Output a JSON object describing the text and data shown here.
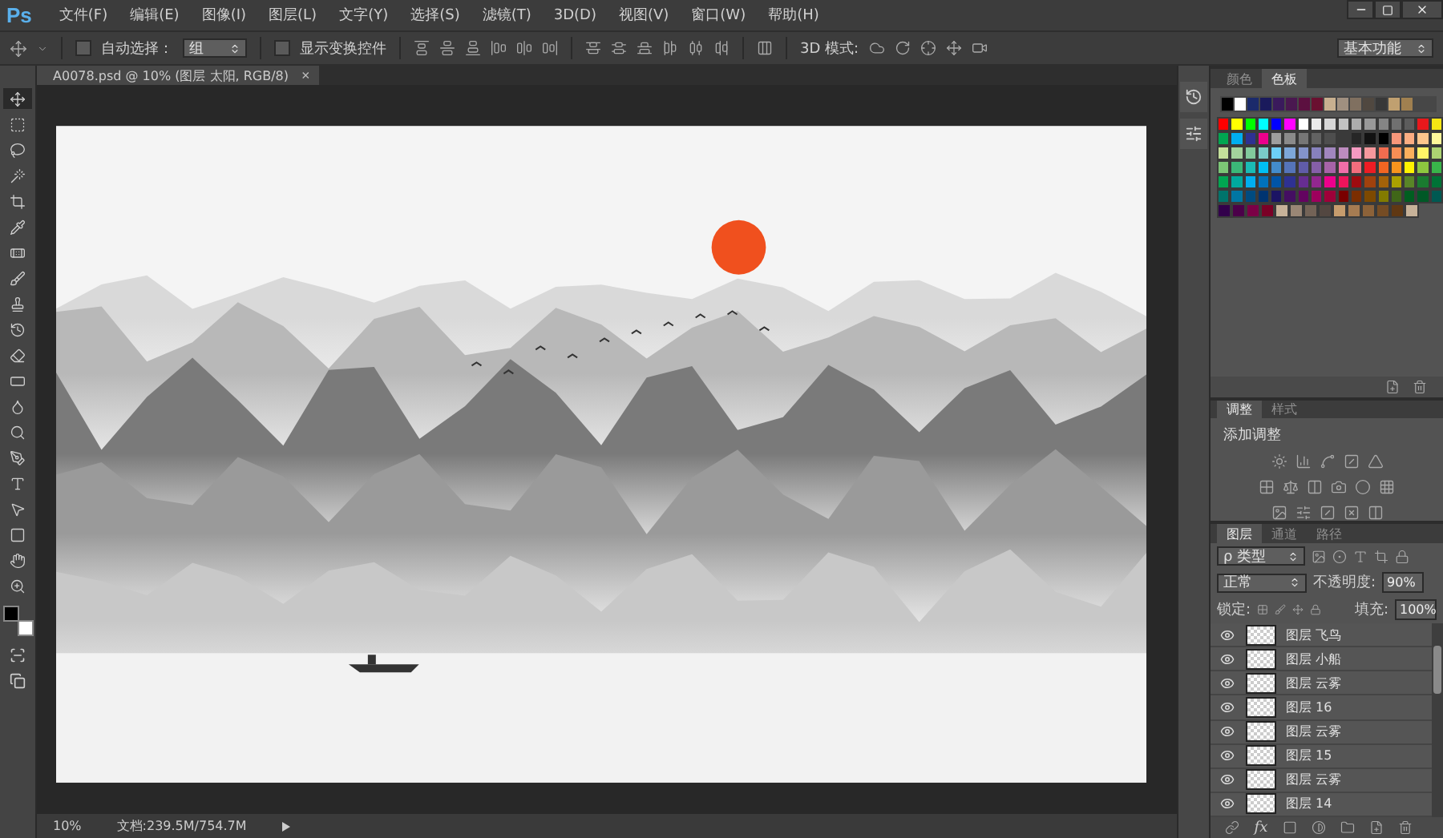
{
  "menu": {
    "logo": "Ps",
    "items": [
      "文件(F)",
      "编辑(E)",
      "图像(I)",
      "图层(L)",
      "文字(Y)",
      "选择(S)",
      "滤镜(T)",
      "3D(D)",
      "视图(V)",
      "窗口(W)",
      "帮助(H)"
    ]
  },
  "options_bar": {
    "auto_select": {
      "label": "自动选择：",
      "checked": false,
      "value": "组"
    },
    "show_transform": {
      "label": "显示变换控件",
      "checked": false
    },
    "mode_label": "3D 模式:",
    "workspace": "基本功能"
  },
  "document_tab": {
    "title": "A0078.psd @ 10% (图层 太阳, RGB/8)",
    "close": "×"
  },
  "tools": [
    {
      "kind": "move",
      "selected": true
    },
    {
      "kind": "marquee",
      "selected": false
    },
    {
      "kind": "lasso",
      "selected": false
    },
    {
      "kind": "wand",
      "selected": false
    },
    {
      "kind": "crop",
      "selected": false
    },
    {
      "kind": "eyedropper",
      "selected": false
    },
    {
      "kind": "heal",
      "selected": false
    },
    {
      "kind": "brush",
      "selected": false
    },
    {
      "kind": "stamp",
      "selected": false
    },
    {
      "kind": "history",
      "selected": false
    },
    {
      "kind": "eraser",
      "selected": false
    },
    {
      "kind": "gradient",
      "selected": false
    },
    {
      "kind": "blur",
      "selected": false
    },
    {
      "kind": "dodge",
      "selected": false
    },
    {
      "kind": "pen",
      "selected": false
    },
    {
      "kind": "type",
      "selected": false
    },
    {
      "kind": "path",
      "selected": false
    },
    {
      "kind": "shape",
      "selected": false
    },
    {
      "kind": "hand",
      "selected": false
    },
    {
      "kind": "zoom",
      "selected": false
    }
  ],
  "colors": [
    {
      "kind": "background",
      "color": "#ffffff"
    },
    {
      "kind": "foreground",
      "color": "#000000"
    }
  ],
  "status_bar": {
    "zoom": "10%",
    "doc_info": "文档:239.5M/754.7M"
  },
  "swatches_panel": {
    "tabs": [
      {
        "label": "颜色",
        "selected": false
      },
      {
        "label": "色板",
        "selected": true
      }
    ],
    "recent": [
      {
        "color": "#000000"
      },
      {
        "color": "#ffffff"
      },
      {
        "color": "#1b2a6b"
      },
      {
        "color": "#1a1a5c"
      },
      {
        "color": "#3a1a5c"
      },
      {
        "color": "#4a1850"
      },
      {
        "color": "#5c1040"
      },
      {
        "color": "#6a1030"
      },
      {
        "color": "#c8b090"
      },
      {
        "color": "#a09080"
      },
      {
        "color": "#807060"
      },
      {
        "color": "#504840"
      },
      {
        "color": "#383838"
      },
      {
        "color": "#c0a070"
      },
      {
        "color": "#a08050"
      }
    ],
    "rows": [
      {
        "swatches": [
          {
            "color": "#ff0000"
          },
          {
            "color": "#ffff00"
          },
          {
            "color": "#00ff00"
          },
          {
            "color": "#00ffff"
          },
          {
            "color": "#0000ff"
          },
          {
            "color": "#ff00ff"
          },
          {
            "color": "#ffffff"
          },
          {
            "color": "#ebebeb"
          },
          {
            "color": "#d6d6d6"
          },
          {
            "color": "#c2c2c2"
          },
          {
            "color": "#adadad"
          },
          {
            "color": "#999999"
          },
          {
            "color": "#858585"
          },
          {
            "color": "#707070"
          },
          {
            "color": "#5c5c5c"
          },
          {
            "color": "#e8181c"
          },
          {
            "color": "#f5e614"
          }
        ]
      },
      {
        "swatches": [
          {
            "color": "#00a651"
          },
          {
            "color": "#00aeef"
          },
          {
            "color": "#2e3192"
          },
          {
            "color": "#ec008c"
          },
          {
            "color": "#9e9e9e"
          },
          {
            "color": "#8a8a8a"
          },
          {
            "color": "#767676"
          },
          {
            "color": "#626262"
          },
          {
            "color": "#4e4e4e"
          },
          {
            "color": "#3a3a3a"
          },
          {
            "color": "#262626"
          },
          {
            "color": "#121212"
          },
          {
            "color": "#000000"
          },
          {
            "color": "#f7977a"
          },
          {
            "color": "#fbad82"
          },
          {
            "color": "#fdc68c"
          },
          {
            "color": "#fff79a"
          }
        ]
      },
      {
        "swatches": [
          {
            "color": "#c4df9b"
          },
          {
            "color": "#a3d39c"
          },
          {
            "color": "#82ca9c"
          },
          {
            "color": "#7accc8"
          },
          {
            "color": "#6dcff6"
          },
          {
            "color": "#7da7d9"
          },
          {
            "color": "#8393ca"
          },
          {
            "color": "#8781bd"
          },
          {
            "color": "#a186be"
          },
          {
            "color": "#bd8cbf"
          },
          {
            "color": "#f49ac1"
          },
          {
            "color": "#f5989d"
          },
          {
            "color": "#f26c4f"
          },
          {
            "color": "#f68e55"
          },
          {
            "color": "#fbaf5c"
          },
          {
            "color": "#fff467"
          },
          {
            "color": "#acd372"
          }
        ]
      },
      {
        "swatches": [
          {
            "color": "#7cc576"
          },
          {
            "color": "#3bb878"
          },
          {
            "color": "#1abbb4"
          },
          {
            "color": "#00bff3"
          },
          {
            "color": "#438ccb"
          },
          {
            "color": "#5574b9"
          },
          {
            "color": "#605ca8"
          },
          {
            "color": "#855fa8"
          },
          {
            "color": "#a763a8"
          },
          {
            "color": "#f06ea9"
          },
          {
            "color": "#f26d7d"
          },
          {
            "color": "#ed1c24"
          },
          {
            "color": "#f26522"
          },
          {
            "color": "#f7941d"
          },
          {
            "color": "#fff200"
          },
          {
            "color": "#8dc73f"
          },
          {
            "color": "#39b54a"
          }
        ]
      },
      {
        "swatches": [
          {
            "color": "#00a651"
          },
          {
            "color": "#00a99d"
          },
          {
            "color": "#00aeef"
          },
          {
            "color": "#0072bc"
          },
          {
            "color": "#0054a6"
          },
          {
            "color": "#2e3192"
          },
          {
            "color": "#662d91"
          },
          {
            "color": "#92278f"
          },
          {
            "color": "#ec008c"
          },
          {
            "color": "#ed145b"
          },
          {
            "color": "#9e0b0f"
          },
          {
            "color": "#a0410d"
          },
          {
            "color": "#a36209"
          },
          {
            "color": "#aba000"
          },
          {
            "color": "#598527"
          },
          {
            "color": "#1a7b30"
          },
          {
            "color": "#007236"
          }
        ]
      },
      {
        "swatches": [
          {
            "color": "#00746b"
          },
          {
            "color": "#0076a3"
          },
          {
            "color": "#004b80"
          },
          {
            "color": "#003471"
          },
          {
            "color": "#1b1464"
          },
          {
            "color": "#440e62"
          },
          {
            "color": "#630460"
          },
          {
            "color": "#9e005d"
          },
          {
            "color": "#9e0039"
          },
          {
            "color": "#790000"
          },
          {
            "color": "#7b2e00"
          },
          {
            "color": "#7d4900"
          },
          {
            "color": "#827b00"
          },
          {
            "color": "#406618"
          },
          {
            "color": "#005e20"
          },
          {
            "color": "#005826"
          },
          {
            "color": "#005952"
          }
        ]
      },
      {
        "swatches": [
          {
            "color": "#32004b"
          },
          {
            "color": "#4b0049"
          },
          {
            "color": "#7b0046"
          },
          {
            "color": "#7a0026"
          },
          {
            "color": "#c7b299"
          },
          {
            "color": "#998675"
          },
          {
            "color": "#736357"
          },
          {
            "color": "#534741"
          },
          {
            "color": "#c69c6d"
          },
          {
            "color": "#a67c52"
          },
          {
            "color": "#8c6239"
          },
          {
            "color": "#754c24"
          },
          {
            "color": "#603813"
          },
          {
            "color": "#c7b299"
          }
        ]
      }
    ]
  },
  "adjustments_panel": {
    "tabs": [
      {
        "label": "调整",
        "selected": true
      },
      {
        "label": "样式",
        "selected": false
      }
    ],
    "title": "添加调整"
  },
  "layers_panel": {
    "tabs": [
      {
        "label": "图层",
        "selected": true
      },
      {
        "label": "通道",
        "selected": false
      },
      {
        "label": "路径",
        "selected": false
      }
    ],
    "filter": "ρ 类型",
    "blend_mode": "正常",
    "opacity_label": "不透明度:",
    "opacity": "90%",
    "lock_label": "锁定:",
    "fill_label": "填充:",
    "fill": "100%",
    "effects_label": "fx",
    "layers": [
      {
        "name": "图层 飞鸟",
        "visible": true
      },
      {
        "name": "图层 小船",
        "visible": true
      },
      {
        "name": "图层 云雾",
        "visible": true
      },
      {
        "name": "图层 16",
        "visible": true
      },
      {
        "name": "图层 云雾",
        "visible": true
      },
      {
        "name": "图层 15",
        "visible": true
      },
      {
        "name": "图层 云雾",
        "visible": true
      },
      {
        "name": "图层 14",
        "visible": true
      }
    ]
  }
}
